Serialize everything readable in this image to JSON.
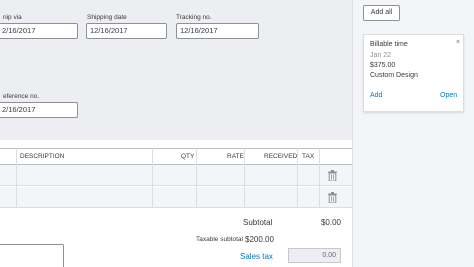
{
  "form": {
    "ship_via_label": "nip via",
    "ship_via_value": "2/16/2017",
    "shipping_date_label": "Shipping date",
    "shipping_date_value": "12/16/2017",
    "tracking_label": "Tracking no.",
    "tracking_value": "12/16/2017",
    "reference_label": "eference no.",
    "reference_value": "2/16/2017"
  },
  "grid": {
    "headers": {
      "description": "DESCRIPTION",
      "qty": "QTY",
      "rate": "RATE",
      "received": "RECEIVED",
      "tax": "TAX"
    },
    "row_count": 2
  },
  "totals": {
    "subtotal_label": "Subtotal",
    "subtotal_value": "$0.00",
    "taxable_label": "Taxable subtotal",
    "taxable_value": "$200.00",
    "sales_tax_label": "Sales tax",
    "sales_tax_value": "0.00"
  },
  "sidebar": {
    "add_all_label": "Add all",
    "card": {
      "title": "Billable time",
      "close": "×",
      "date": "Jan 22",
      "amount": "$375.00",
      "description": "Custom Design",
      "add_label": "Add",
      "open_label": "Open"
    }
  },
  "colors": {
    "link": "#0077c5",
    "form_bg": "#eceef1",
    "sidebar_bg": "#f4f5f8"
  },
  "icons": {
    "row_delete": "trash-icon"
  }
}
